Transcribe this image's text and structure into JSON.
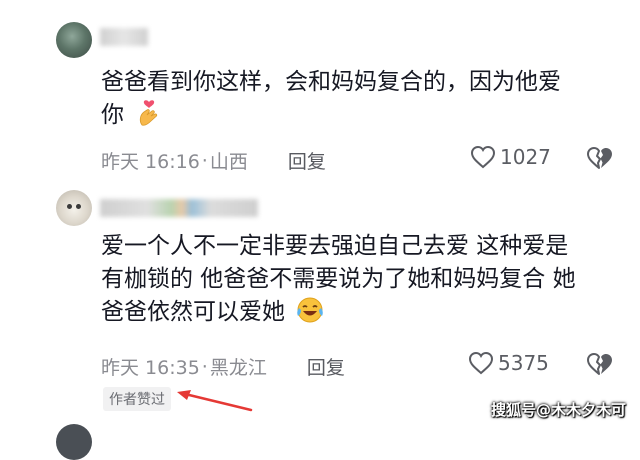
{
  "comments": [
    {
      "text_line1": "爸爸看到你这样，会和妈妈复合的，因为他爱",
      "text_line2": "你",
      "time": "昨天 16:16",
      "location": "山西",
      "reply_label": "回复",
      "like_count": "1027"
    },
    {
      "text_line1": "爱一个人不一定非要去强迫自己去爱 这种爱是",
      "text_line2": "有枷锁的 他爸爸不需要说为了她和妈妈复合 她",
      "text_line3": "爸爸依然可以爱她",
      "time": "昨天 16:35",
      "location": "黑龙江",
      "reply_label": "回复",
      "like_count": "5375",
      "author_badge": "作者赞过"
    }
  ],
  "meta_separator": "·",
  "watermark": "搜狐号@木木夕木可",
  "colors": {
    "text": "#161823",
    "meta": "#8a8b91",
    "annotation_arrow": "#e53935"
  },
  "icons": [
    "heart-hands-emoji",
    "laughing-crying-emoji",
    "heart-outline-icon",
    "broken-heart-icon",
    "red-arrow"
  ]
}
